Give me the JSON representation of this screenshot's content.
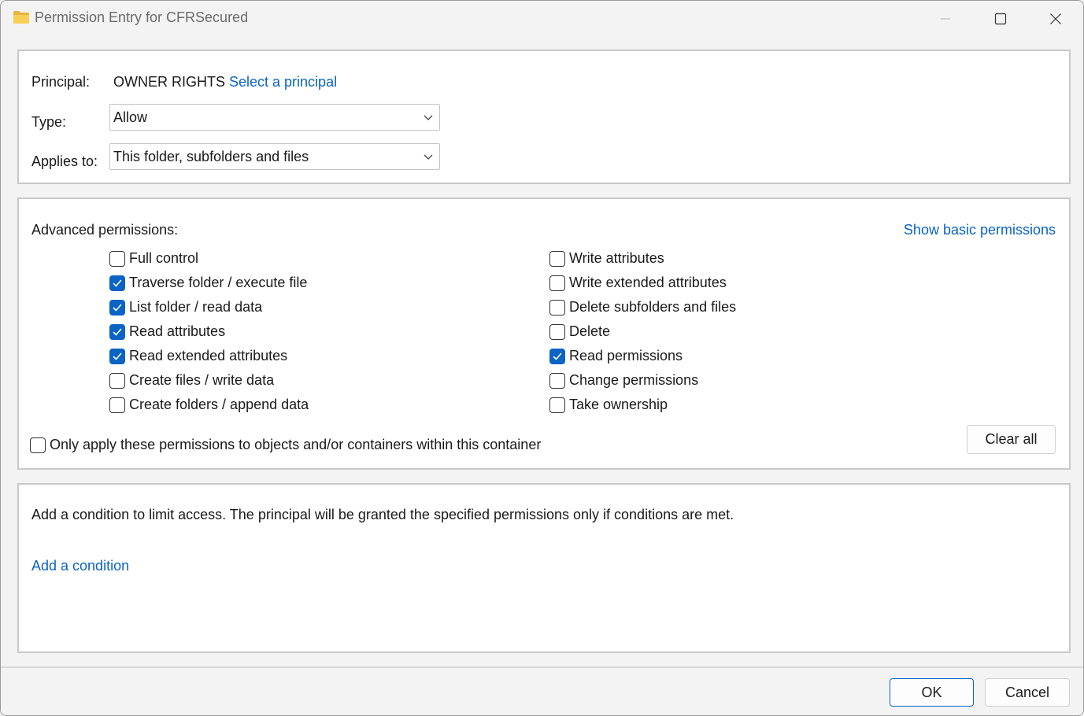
{
  "window": {
    "title": "Permission Entry for CFRSecured",
    "icon": "folder-icon",
    "controls": [
      "minimize-icon",
      "maximize-icon",
      "close-icon"
    ]
  },
  "principal": {
    "label": "Principal:",
    "value": "OWNER RIGHTS",
    "link": "Select a principal"
  },
  "type": {
    "label": "Type:",
    "value": "Allow"
  },
  "applies_to": {
    "label": "Applies to:",
    "value": "This folder, subfolders and files"
  },
  "advanced": {
    "label": "Advanced permissions:",
    "show_basic_link": "Show basic permissions",
    "left": [
      {
        "label": "Full control",
        "checked": false
      },
      {
        "label": "Traverse folder / execute file",
        "checked": true
      },
      {
        "label": "List folder / read data",
        "checked": true
      },
      {
        "label": "Read attributes",
        "checked": true
      },
      {
        "label": "Read extended attributes",
        "checked": true
      },
      {
        "label": "Create files / write data",
        "checked": false
      },
      {
        "label": "Create folders / append data",
        "checked": false
      }
    ],
    "right": [
      {
        "label": "Write attributes",
        "checked": false
      },
      {
        "label": "Write extended attributes",
        "checked": false
      },
      {
        "label": "Delete subfolders and files",
        "checked": false
      },
      {
        "label": "Delete",
        "checked": false
      },
      {
        "label": "Read permissions",
        "checked": true
      },
      {
        "label": "Change permissions",
        "checked": false
      },
      {
        "label": "Take ownership",
        "checked": false
      }
    ],
    "only_apply": {
      "label": "Only apply these permissions to objects and/or containers within this container",
      "checked": false
    },
    "clear_all": "Clear all"
  },
  "condition": {
    "text": "Add a condition to limit access. The principal will be granted the specified permissions only if conditions are met.",
    "link": "Add a condition"
  },
  "footer": {
    "ok": "OK",
    "cancel": "Cancel"
  },
  "colors": {
    "accent": "#0b63c4",
    "panel_border": "#c8c8c8",
    "background": "#f3f3f3"
  }
}
